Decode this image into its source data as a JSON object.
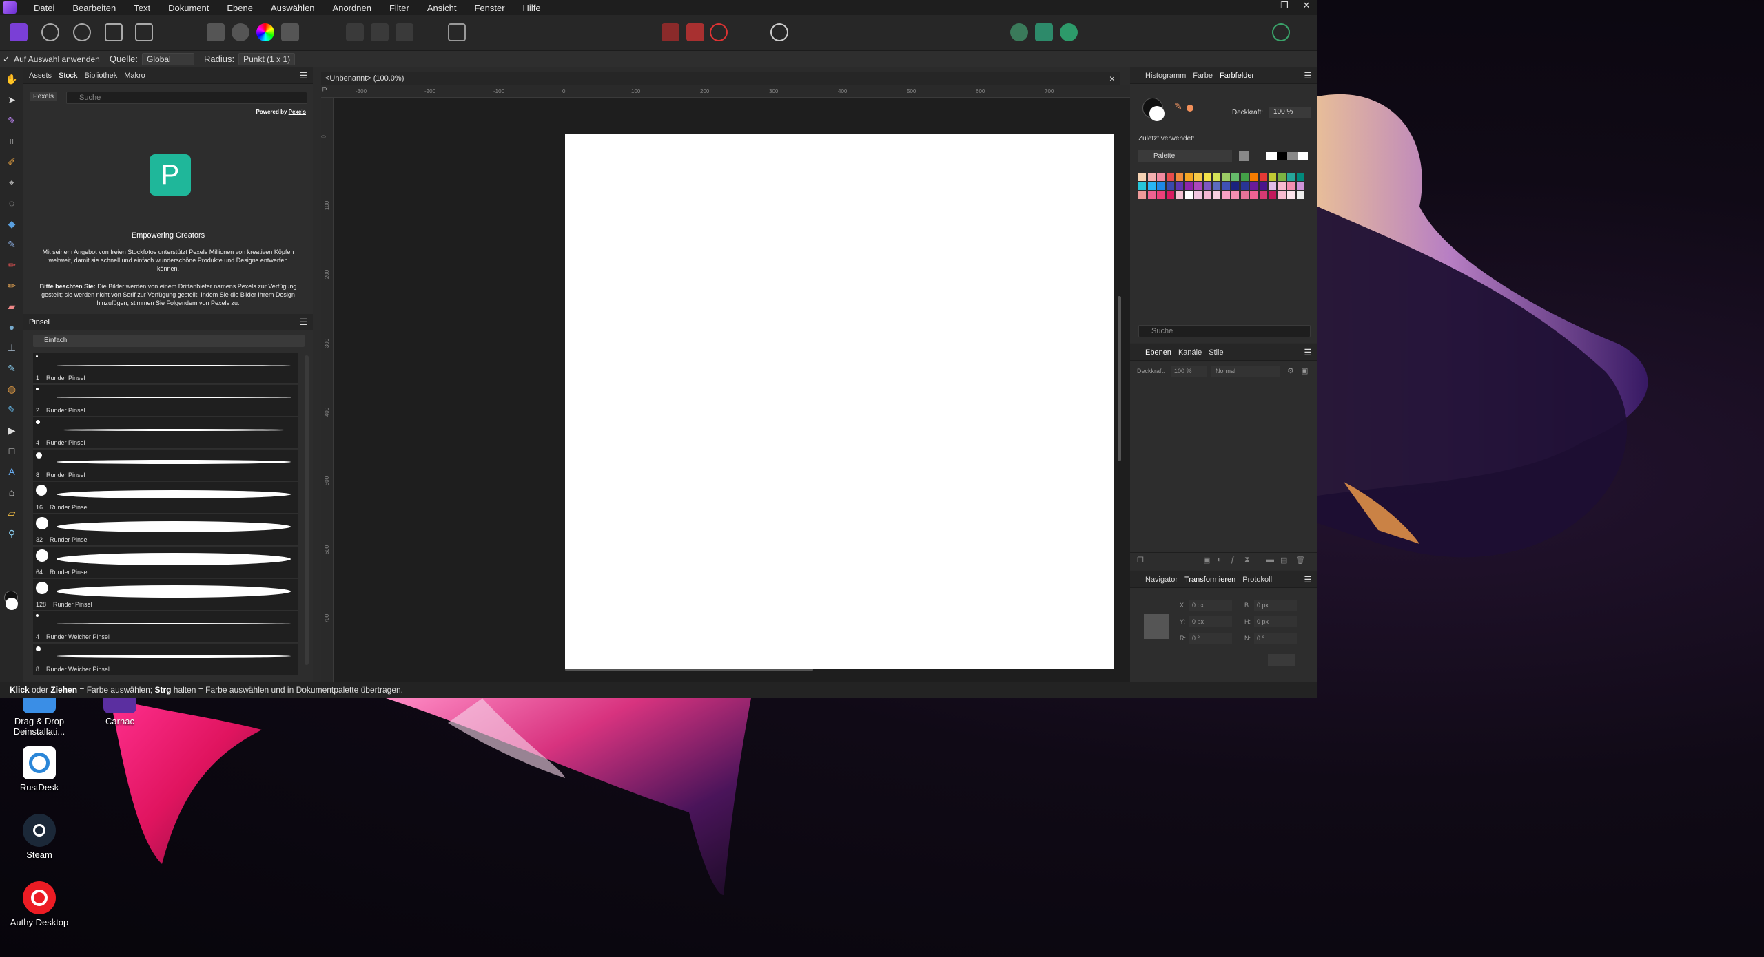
{
  "desktop": {
    "icons": [
      {
        "label": "Drag & Drop Deinstallati...",
        "icon": "drag-drop-icon",
        "color": "#3a8ee6"
      },
      {
        "label": "Carnac",
        "icon": "carnac-icon",
        "color": "#5b2fa0"
      },
      {
        "label": "RustDesk",
        "icon": "rustdesk-icon",
        "color": "#2a86d8"
      },
      {
        "label": "Steam",
        "icon": "steam-icon",
        "color": "#1b2838"
      },
      {
        "label": "Authy Desktop",
        "icon": "authy-icon",
        "color": "#ec1c24"
      }
    ]
  },
  "app": {
    "menu": [
      "Datei",
      "Bearbeiten",
      "Text",
      "Dokument",
      "Ebene",
      "Auswählen",
      "Anordnen",
      "Filter",
      "Ansicht",
      "Fenster",
      "Hilfe"
    ],
    "window_buttons": [
      "–",
      "❐",
      "✕"
    ],
    "context_bar": {
      "apply_label": "Auf Auswahl anwenden",
      "source_label": "Quelle:",
      "source_value": "Global",
      "radius_label": "Radius:",
      "radius_value": "Punkt (1 x 1)"
    },
    "left_panel": {
      "tabs": [
        "Assets",
        "Stock",
        "Bibliothek",
        "Makro"
      ],
      "active_tab": "Stock",
      "provider": "Pexels",
      "search_placeholder": "Suche",
      "powered_by": "Powered by",
      "powered_by_link": "Pexels",
      "logo_letter": "P",
      "heading": "Empowering Creators",
      "paragraph1": "Mit seinem Angebot von freien Stockfotos unterstützt Pexels Millionen von kreativen Köpfen weltweit, damit sie schnell und einfach wunderschöne Produkte und Designs entwerfen können.",
      "paragraph2_bold": "Bitte beachten Sie:",
      "paragraph2": " Die Bilder werden von einem Drittanbieter namens Pexels zur Verfügung gestellt; sie werden nicht von Serif zur Verfügung gestellt. Indem Sie die Bilder Ihrem Design hinzufügen, stimmen Sie Folgendem von Pexels zu:"
    },
    "brush_panel": {
      "tab": "Pinsel",
      "category": "Einfach",
      "brushes": [
        {
          "size": "1",
          "name": "Runder Pinsel"
        },
        {
          "size": "2",
          "name": "Runder Pinsel"
        },
        {
          "size": "4",
          "name": "Runder Pinsel"
        },
        {
          "size": "8",
          "name": "Runder Pinsel"
        },
        {
          "size": "16",
          "name": "Runder Pinsel"
        },
        {
          "size": "32",
          "name": "Runder Pinsel"
        },
        {
          "size": "64",
          "name": "Runder Pinsel"
        },
        {
          "size": "128",
          "name": "Runder Pinsel"
        },
        {
          "size": "4",
          "name": "Runder Weicher Pinsel"
        },
        {
          "size": "8",
          "name": "Runder Weicher Pinsel"
        }
      ]
    },
    "document": {
      "tab_title": "<Unbenannt> (100.0%)",
      "close": "×",
      "ruler_unit": "px",
      "h_ticks": [
        "-300",
        "-200",
        "-100",
        "0",
        "100",
        "200",
        "300",
        "400",
        "500",
        "600",
        "700"
      ],
      "v_ticks": [
        "0",
        "100",
        "200",
        "300",
        "400",
        "500",
        "600",
        "700"
      ]
    },
    "right_top": {
      "tabs": [
        "Histogramm",
        "Farbe",
        "Farbfelder"
      ],
      "active_tab": "Farbfelder",
      "opacity_label": "Deckkraft:",
      "opacity_value": "100 %",
      "recent_label": "Zuletzt verwendet:",
      "palette_name": "Palette",
      "search_placeholder": "Suche",
      "swatches": [
        "#f6d3b4",
        "#f4b0b0",
        "#f28aa0",
        "#e84c4c",
        "#f08c3c",
        "#f5a623",
        "#f7c948",
        "#f3e24a",
        "#d4e157",
        "#9ccc65",
        "#66bb6a",
        "#43a047",
        "#f57c00",
        "#e53935",
        "#c0ca33",
        "#7cb342",
        "#26a69a",
        "#00897b",
        "#26c6da",
        "#29b6f6",
        "#1e88e5",
        "#3949ab",
        "#5e35b1",
        "#8e24aa",
        "#ab47bc",
        "#7e57c2",
        "#5c6bc0",
        "#3f51b5",
        "#1a237e",
        "#283593",
        "#6a1b9a",
        "#4a148c",
        "#e1bee7",
        "#f8bbd0",
        "#f48fb1",
        "#ce93d8",
        "#ef9a9a",
        "#f06292",
        "#ec407a",
        "#d81b60",
        "#f3c1d1",
        "#ffffff",
        "#f1c6e0",
        "#f4b8d4",
        "#f9d0e0",
        "#f7a1c4",
        "#f48fb1",
        "#e57398",
        "#f06292",
        "#d63a73",
        "#c2185b",
        "#f8bbd0",
        "#fce4ec",
        "#eeeeee"
      ]
    },
    "layers": {
      "tabs": [
        "Ebenen",
        "Kanäle",
        "Stile"
      ],
      "active_tab": "Ebenen",
      "opacity_label": "Deckkraft:",
      "opacity_value": "100 %",
      "blend_mode": "Normal"
    },
    "transform": {
      "tabs": [
        "Navigator",
        "Transformieren",
        "Protokoll"
      ],
      "active_tab": "Transformieren",
      "fields": [
        {
          "label": "X:",
          "value": "0 px"
        },
        {
          "label": "B:",
          "value": "0 px"
        },
        {
          "label": "Y:",
          "value": "0 px"
        },
        {
          "label": "H:",
          "value": "0 px"
        },
        {
          "label": "R:",
          "value": "0 °"
        },
        {
          "label": "N:",
          "value": "0 °"
        }
      ]
    },
    "status": {
      "b1": "Klick",
      "t1": " oder ",
      "b2": "Ziehen",
      "t2": " = Farbe auswählen; ",
      "b3": "Strg",
      "t3": " halten = Farbe auswählen und in Dokumentpalette übertragen."
    }
  }
}
